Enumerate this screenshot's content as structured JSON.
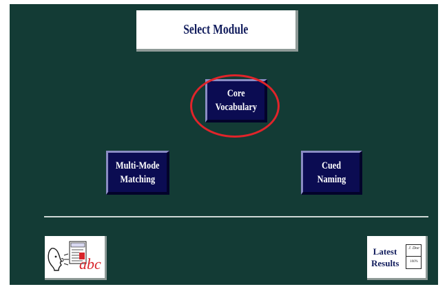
{
  "header": {
    "title": "Select Module"
  },
  "modules": {
    "core": {
      "line1": "Core",
      "line2": "Vocabulary"
    },
    "multi_mode": {
      "line1": "Multi-Mode",
      "line2": "Matching"
    },
    "cued": {
      "line1": "Cued",
      "line2": "Naming"
    }
  },
  "footer": {
    "abc_label": "abc",
    "abc_icon": "spelling-practice-icon",
    "results_line1": "Latest",
    "results_line2": "Results",
    "results_icon": "report-card-icon",
    "report_name": "J. Doe",
    "report_score": "100%"
  },
  "colors": {
    "background": "#133b35",
    "button": "#0b0c52",
    "highlight": "#e0242a",
    "title_text": "#111c5c"
  }
}
